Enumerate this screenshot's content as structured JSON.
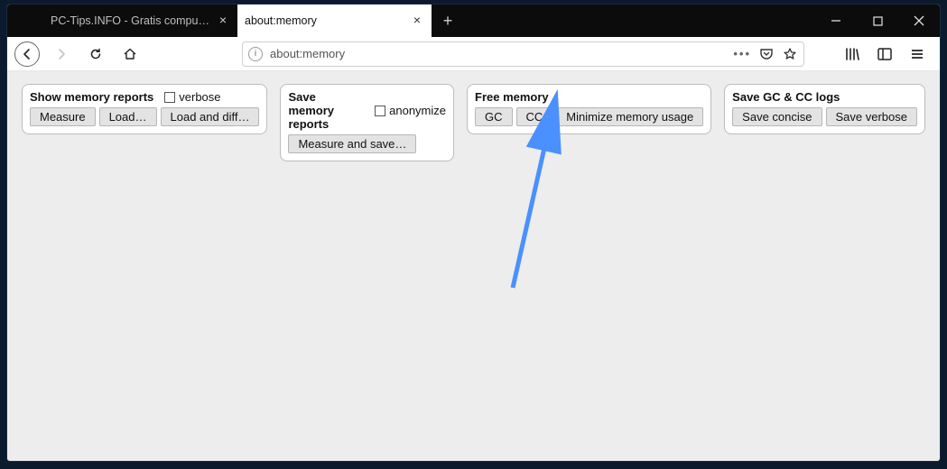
{
  "window": {
    "minimize": "−",
    "maximize": "▢",
    "close": "×"
  },
  "tabs": [
    {
      "label": "PC-Tips.INFO - Gratis computer tips",
      "active": false
    },
    {
      "label": "about:memory",
      "active": true
    }
  ],
  "newtab_glyph": "+",
  "toolbar": {
    "back_enabled": true,
    "forward_enabled": false,
    "reload": "↻",
    "home": "⌂",
    "url": "about:memory",
    "page_actions": "•••"
  },
  "panels": {
    "show": {
      "title": "Show memory reports",
      "checkbox": "verbose",
      "buttons": [
        "Measure",
        "Load…",
        "Load and diff…"
      ]
    },
    "save": {
      "title": "Save memory reports",
      "checkbox": "anonymize",
      "buttons": [
        "Measure and save…"
      ]
    },
    "free": {
      "title": "Free memory",
      "buttons": [
        "GC",
        "CC",
        "Minimize memory usage"
      ]
    },
    "logs": {
      "title": "Save GC & CC logs",
      "buttons": [
        "Save concise",
        "Save verbose"
      ]
    }
  }
}
